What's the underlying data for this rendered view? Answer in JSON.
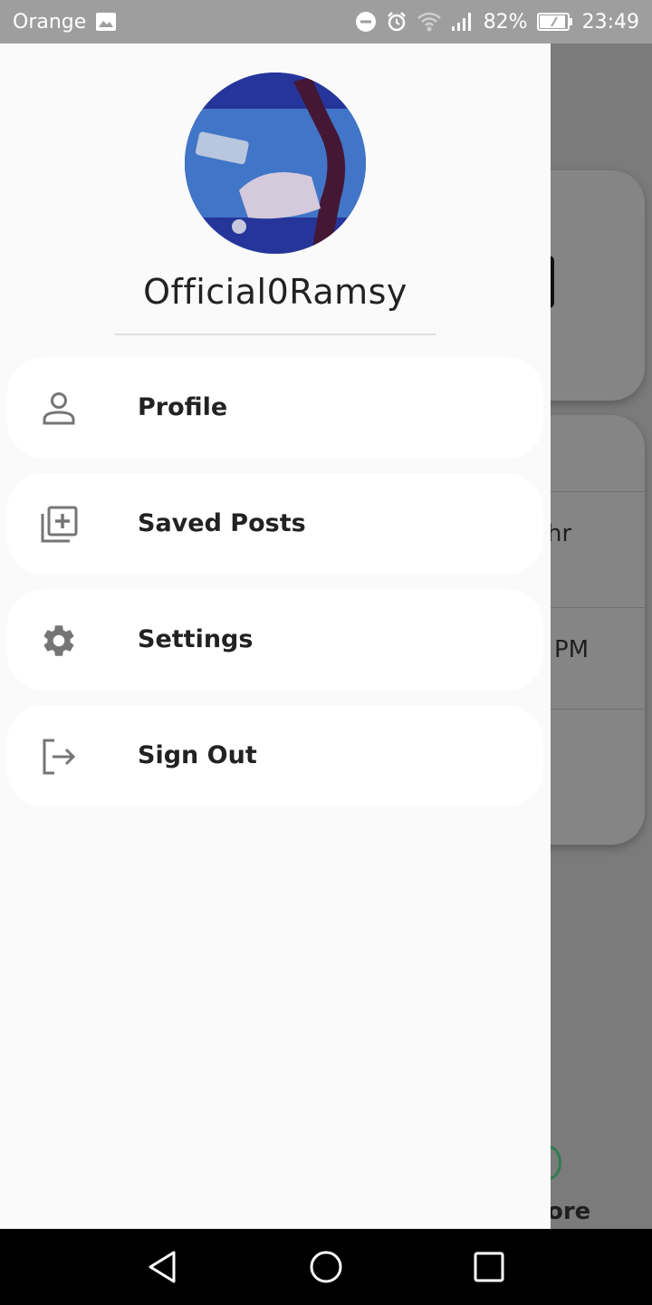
{
  "status_bar": {
    "carrier": "Orange",
    "battery": "82%",
    "time": "23:49",
    "icons": [
      "image-icon",
      "dnd-icon",
      "alarm-icon",
      "wifi-icon",
      "signal-icon",
      "battery-icon"
    ]
  },
  "drawer": {
    "username": "Official0Ramsy",
    "menu": [
      {
        "label": "Profile",
        "icon": "person-icon"
      },
      {
        "label": "Saved Posts",
        "icon": "library-add-icon"
      },
      {
        "label": "Settings",
        "icon": "gear-icon"
      },
      {
        "label": "Sign Out",
        "icon": "sign-out-icon"
      }
    ]
  },
  "background": {
    "text_partial_1": "hr",
    "text_partial_2": "PM",
    "text_partial_3": "ore"
  },
  "colors": {
    "drawer_bg": "#fafafa",
    "scrim": "#7b7b7b",
    "status_bar": "#9e9e9e",
    "icon_gray": "#757575",
    "accent_green": "#2e7d4f"
  },
  "nav_bar": {
    "icons": [
      "back-icon",
      "home-icon",
      "recents-icon"
    ]
  }
}
